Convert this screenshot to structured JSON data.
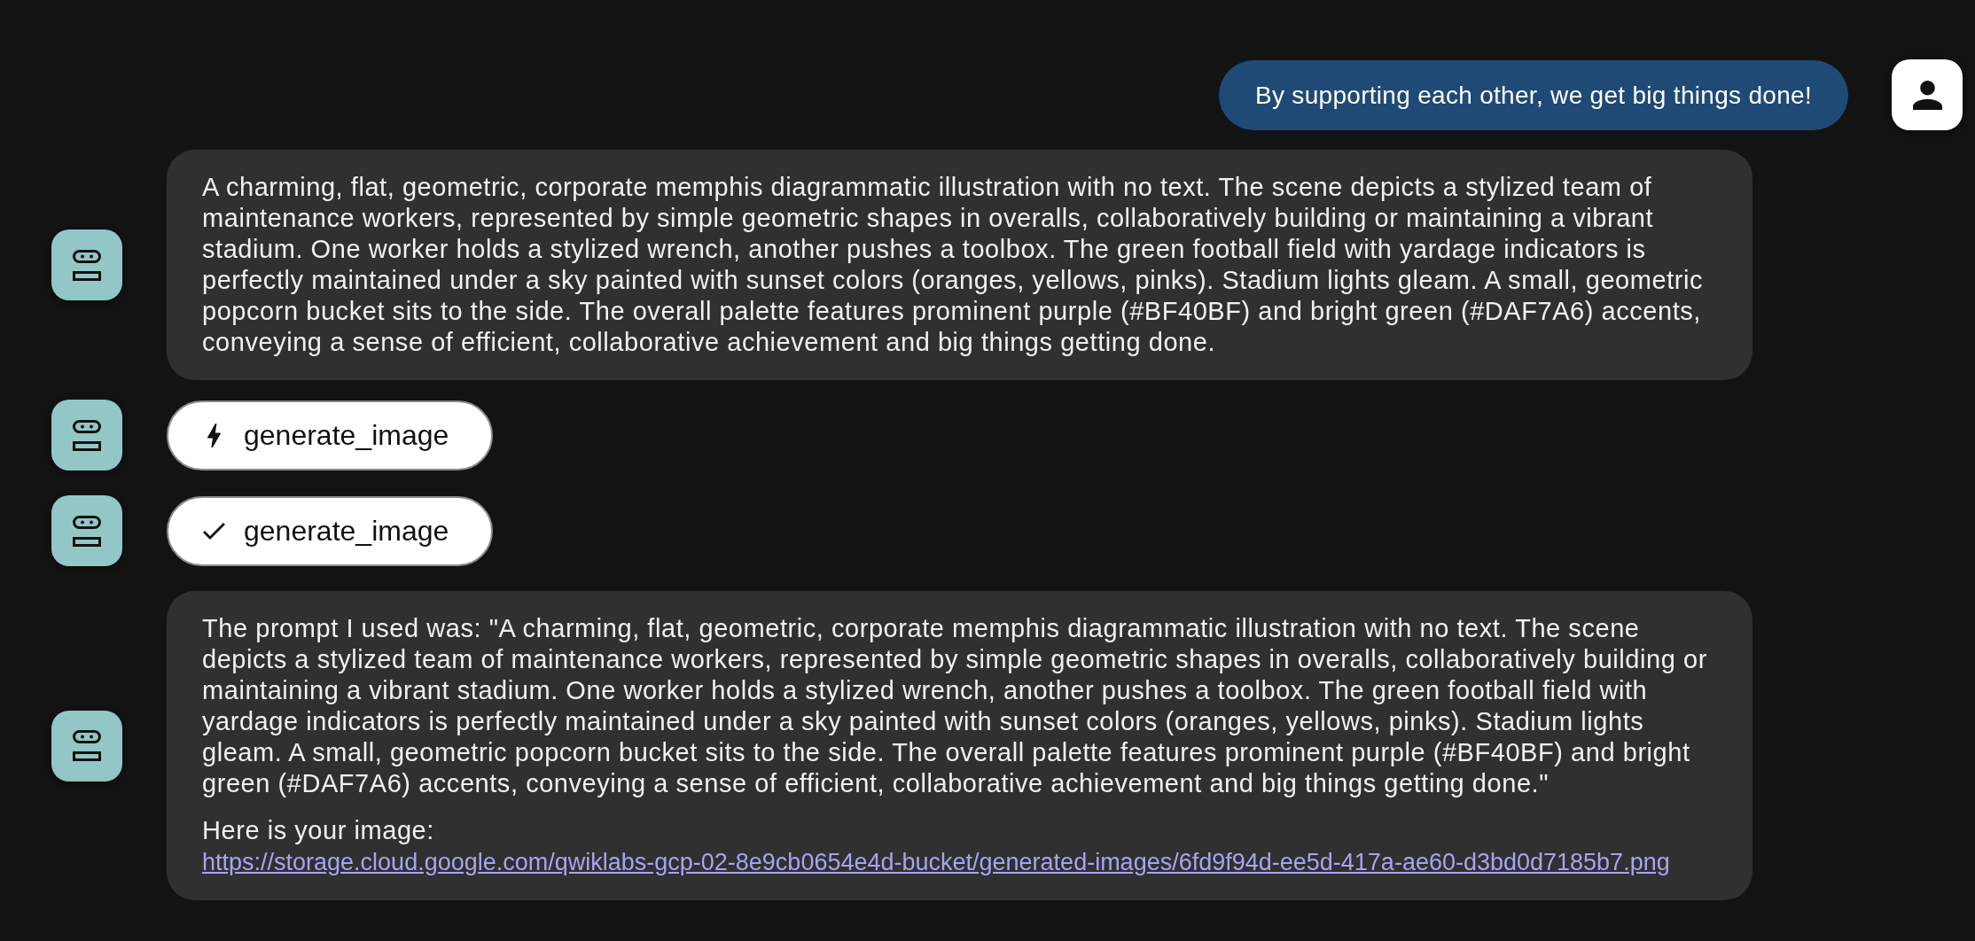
{
  "messages": [
    {
      "from_user": true,
      "kind": "text",
      "paragraphs": [
        {
          "text": "By supporting each other, we get big things done!"
        }
      ]
    },
    {
      "from_user": false,
      "kind": "text",
      "paragraphs": [
        {
          "text": "A charming, flat, geometric, corporate memphis diagrammatic illustration with no text. The scene depicts a stylized team of maintenance workers, represented by simple geometric shapes in overalls, collaboratively building or maintaining a vibrant stadium. One worker holds a stylized wrench, another pushes a toolbox. The green football field with yardage indicators is perfectly maintained under a sky painted with sunset colors (oranges, yellows, pinks). Stadium lights gleam. A small, geometric popcorn bucket sits to the side. The overall palette features prominent purple (#BF40BF) and bright green (#DAF7A6) accents, conveying a sense of efficient, collaborative achievement and big things getting done."
        }
      ]
    },
    {
      "from_user": false,
      "kind": "function_call",
      "label": "generate_image"
    },
    {
      "from_user": false,
      "kind": "function_response",
      "label": "generate_image"
    },
    {
      "from_user": false,
      "kind": "text",
      "paragraphs": [
        {
          "text": "The prompt I used was: \"A charming, flat, geometric, corporate memphis diagrammatic illustration with no text. The scene depicts a stylized team of maintenance workers, represented by simple geometric shapes in overalls, collaboratively building or maintaining a vibrant stadium. One worker holds a stylized wrench, another pushes a toolbox. The green football field with yardage indicators is perfectly maintained under a sky painted with sunset colors (oranges, yellows, pinks). Stadium lights gleam. A small, geometric popcorn bucket sits to the side. The overall palette features prominent purple (#BF40BF) and bright green (#DAF7A6) accents, conveying a sense of efficient, collaborative achievement and big things getting done.\""
        },
        {
          "text": "Here is your image:",
          "link": "https://storage.cloud.google.com/qwiklabs-gcp-02-8e9cb0654e4d-bucket/generated-images/6fd9f94d-ee5d-417a-ae60-d3bd0d7185b7.png"
        }
      ]
    }
  ]
}
